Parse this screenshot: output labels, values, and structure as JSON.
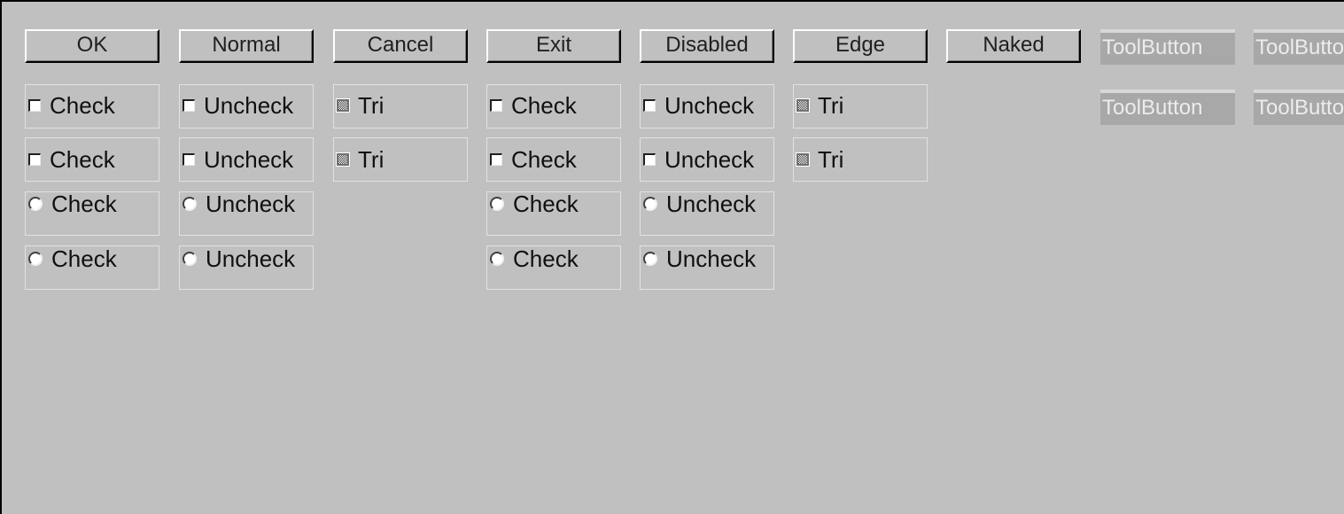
{
  "buttons": {
    "ok": "OK",
    "normal": "Normal",
    "cancel": "Cancel",
    "exit": "Exit",
    "disabled": "Disabled",
    "edge": "Edge",
    "naked": "Naked"
  },
  "tool_buttons": {
    "row1_col1": "ToolButton",
    "row1_col2": "ToolButton",
    "row2_col1": "ToolButton",
    "row2_col2": "ToolButton"
  },
  "checkboxes": {
    "row1": [
      "Check",
      "Uncheck",
      "Tri",
      "Check",
      "Uncheck",
      "Tri"
    ],
    "row2": [
      "Check",
      "Uncheck",
      "Tri",
      "Check",
      "Uncheck",
      "Tri"
    ]
  },
  "radios": {
    "row1": [
      "Check",
      "Uncheck",
      "Check",
      "Uncheck"
    ],
    "row2": [
      "Check",
      "Uncheck",
      "Check",
      "Uncheck"
    ]
  },
  "colors": {
    "background": "#c0c0c0",
    "tool_button_bg": "#a8a8a8",
    "tool_button_text": "#ececec"
  }
}
